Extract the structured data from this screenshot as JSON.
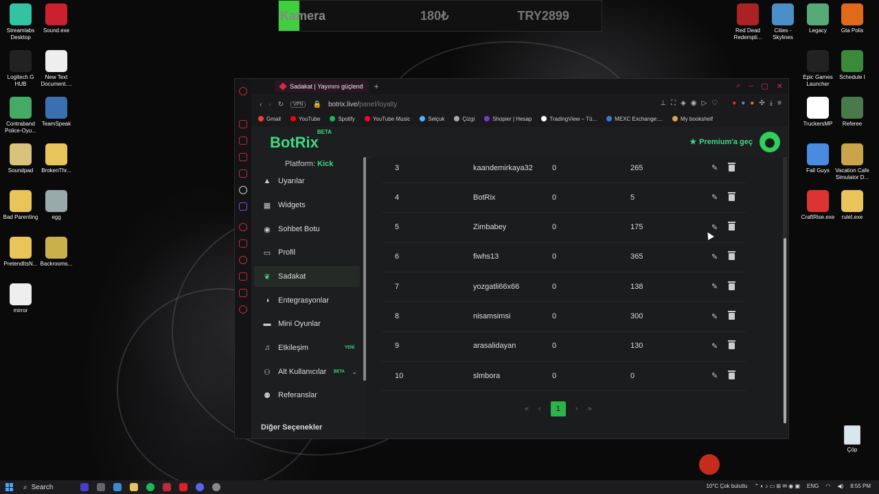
{
  "desktop_left": [
    {
      "label": "Streamlabs Desktop",
      "color": "#31c3a2"
    },
    {
      "label": "Sound.exe",
      "color": "#cc2030"
    },
    {
      "label": "Logitech G HUB",
      "color": "#222"
    },
    {
      "label": "New Text Document....",
      "color": "#eee"
    },
    {
      "label": "Contraband Police-Oyu...",
      "color": "#4a6"
    },
    {
      "label": "TeamSpeak",
      "color": "#3a6fb0"
    },
    {
      "label": "Soundpad",
      "color": "#d9c27a"
    },
    {
      "label": "BrokenThr...",
      "color": "#e8c45b"
    },
    {
      "label": "Bad Parenting",
      "color": "#e8c45b"
    },
    {
      "label": "egg",
      "color": "#9aa"
    },
    {
      "label": "PretendItsN...",
      "color": "#e8c45b"
    },
    {
      "label": "Backrooms...",
      "color": "#c9b04a"
    },
    {
      "label": "mirror",
      "color": "#eee"
    }
  ],
  "desktop_right": [
    {
      "label": "Red Dead Redempti...",
      "color": "#a22"
    },
    {
      "label": "Cities - Skylines",
      "color": "#4a8fc9"
    },
    {
      "label": "Legacy",
      "color": "#5a7"
    },
    {
      "label": "Gta Polis",
      "color": "#e06a1a"
    },
    {
      "label": "Epic Games Launcher",
      "color": "#222"
    },
    {
      "label": "Schedule I",
      "color": "#3a8a3a"
    },
    {
      "label": "TruckersMP",
      "color": "#fff"
    },
    {
      "label": "Referee",
      "color": "#4a7a4a"
    },
    {
      "label": "Fall Guys",
      "color": "#4a8ae0"
    },
    {
      "label": "Vacation Cafe Simulator D...",
      "color": "#c9a44a"
    },
    {
      "label": "CraftRise.exe",
      "color": "#d33"
    },
    {
      "label": "rulet.exe",
      "color": "#e8c45b"
    }
  ],
  "overlay": {
    "title": "Kamera",
    "price": "180₺",
    "try": "TRY2899"
  },
  "browser": {
    "tab_title": "Sadakat | Yayınını güçlend",
    "url_host": "botrix.live/",
    "url_path": "panel/loyalty",
    "vpn": "VPN",
    "bookmarks": [
      "Gmail",
      "YouTube",
      "Spotify",
      "YouTube Music",
      "Selçuk",
      "Çizgi",
      "Shopier | Hesap",
      "TradingView – Tü...",
      "MEXC Exchange:...",
      "My bookshelf"
    ],
    "bookmark_colors": [
      "#ea4335",
      "#ff0000",
      "#1db954",
      "#ff0033",
      "#4db6ff",
      "#aaa",
      "#7a3ad0",
      "#fff",
      "#3a7bd5",
      "#e0a24a"
    ]
  },
  "app": {
    "logo": "BotRix",
    "logo_badge": "BETA",
    "premium": "Premium'a geç",
    "platform_label": "Platform:",
    "platform_value": "Kick",
    "nav": [
      {
        "label": "Uyarılar",
        "icon": "▲"
      },
      {
        "label": "Widgets",
        "icon": "▦"
      },
      {
        "label": "Sohbet Botu",
        "icon": "◉"
      },
      {
        "label": "Profil",
        "icon": "▭"
      },
      {
        "label": "Sadakat",
        "icon": "❦"
      },
      {
        "label": "Entegrasyonlar",
        "icon": "◑"
      },
      {
        "label": "Mini Oyunlar",
        "icon": "▬"
      },
      {
        "label": "Etkileşim",
        "icon": "♫"
      },
      {
        "label": "Alt Kullanıcılar",
        "icon": "⚇"
      },
      {
        "label": "Referanslar",
        "icon": "⚉"
      }
    ],
    "nav_new": "YENİ",
    "nav_beta": "BETA",
    "other_options": "Diğer Seçenekler"
  },
  "table": {
    "rows": [
      [
        "3",
        "kaandemirkaya32",
        "0",
        "265"
      ],
      [
        "4",
        "BotRix",
        "0",
        "5"
      ],
      [
        "5",
        "Zimbabey",
        "0",
        "175"
      ],
      [
        "6",
        "fiwhs13",
        "0",
        "365"
      ],
      [
        "7",
        "yozgatli66x66",
        "0",
        "138"
      ],
      [
        "8",
        "nisamsimsi",
        "0",
        "300"
      ],
      [
        "9",
        "arasalidayan",
        "0",
        "130"
      ],
      [
        "10",
        "slmbora",
        "0",
        "0"
      ]
    ]
  },
  "pager": {
    "first": "«",
    "prev": "‹",
    "current": "1",
    "next": "›",
    "last": "»"
  },
  "taskbar": {
    "search": "Search",
    "weather": "10°C  Çok bulutlu",
    "lang": "ENG",
    "time": "8:55 PM"
  },
  "recycle_bin": "Çöp"
}
